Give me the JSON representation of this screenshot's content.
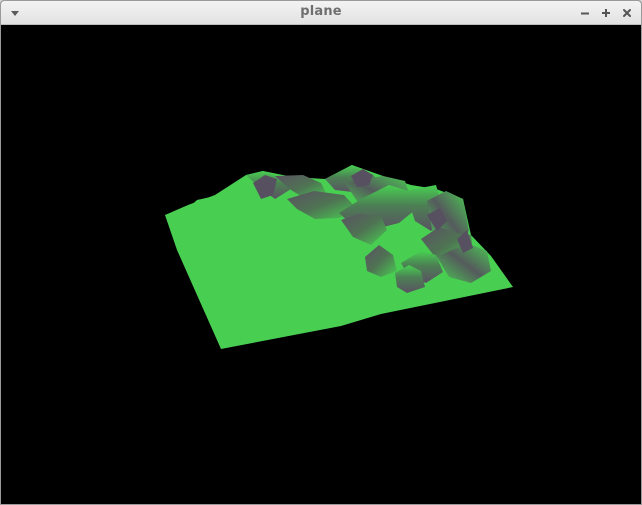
{
  "window": {
    "title": "plane",
    "controls": {
      "menu_icon": "triangle-down-icon",
      "minimize_icon": "minus-icon",
      "maximize_icon": "plus-icon",
      "close_icon": "close-icon"
    }
  },
  "scene": {
    "background_color": "#000000",
    "terrain_color": "#48cf52",
    "shadow_color": "#575060",
    "description_role": "3d-terrain-plane-render"
  }
}
